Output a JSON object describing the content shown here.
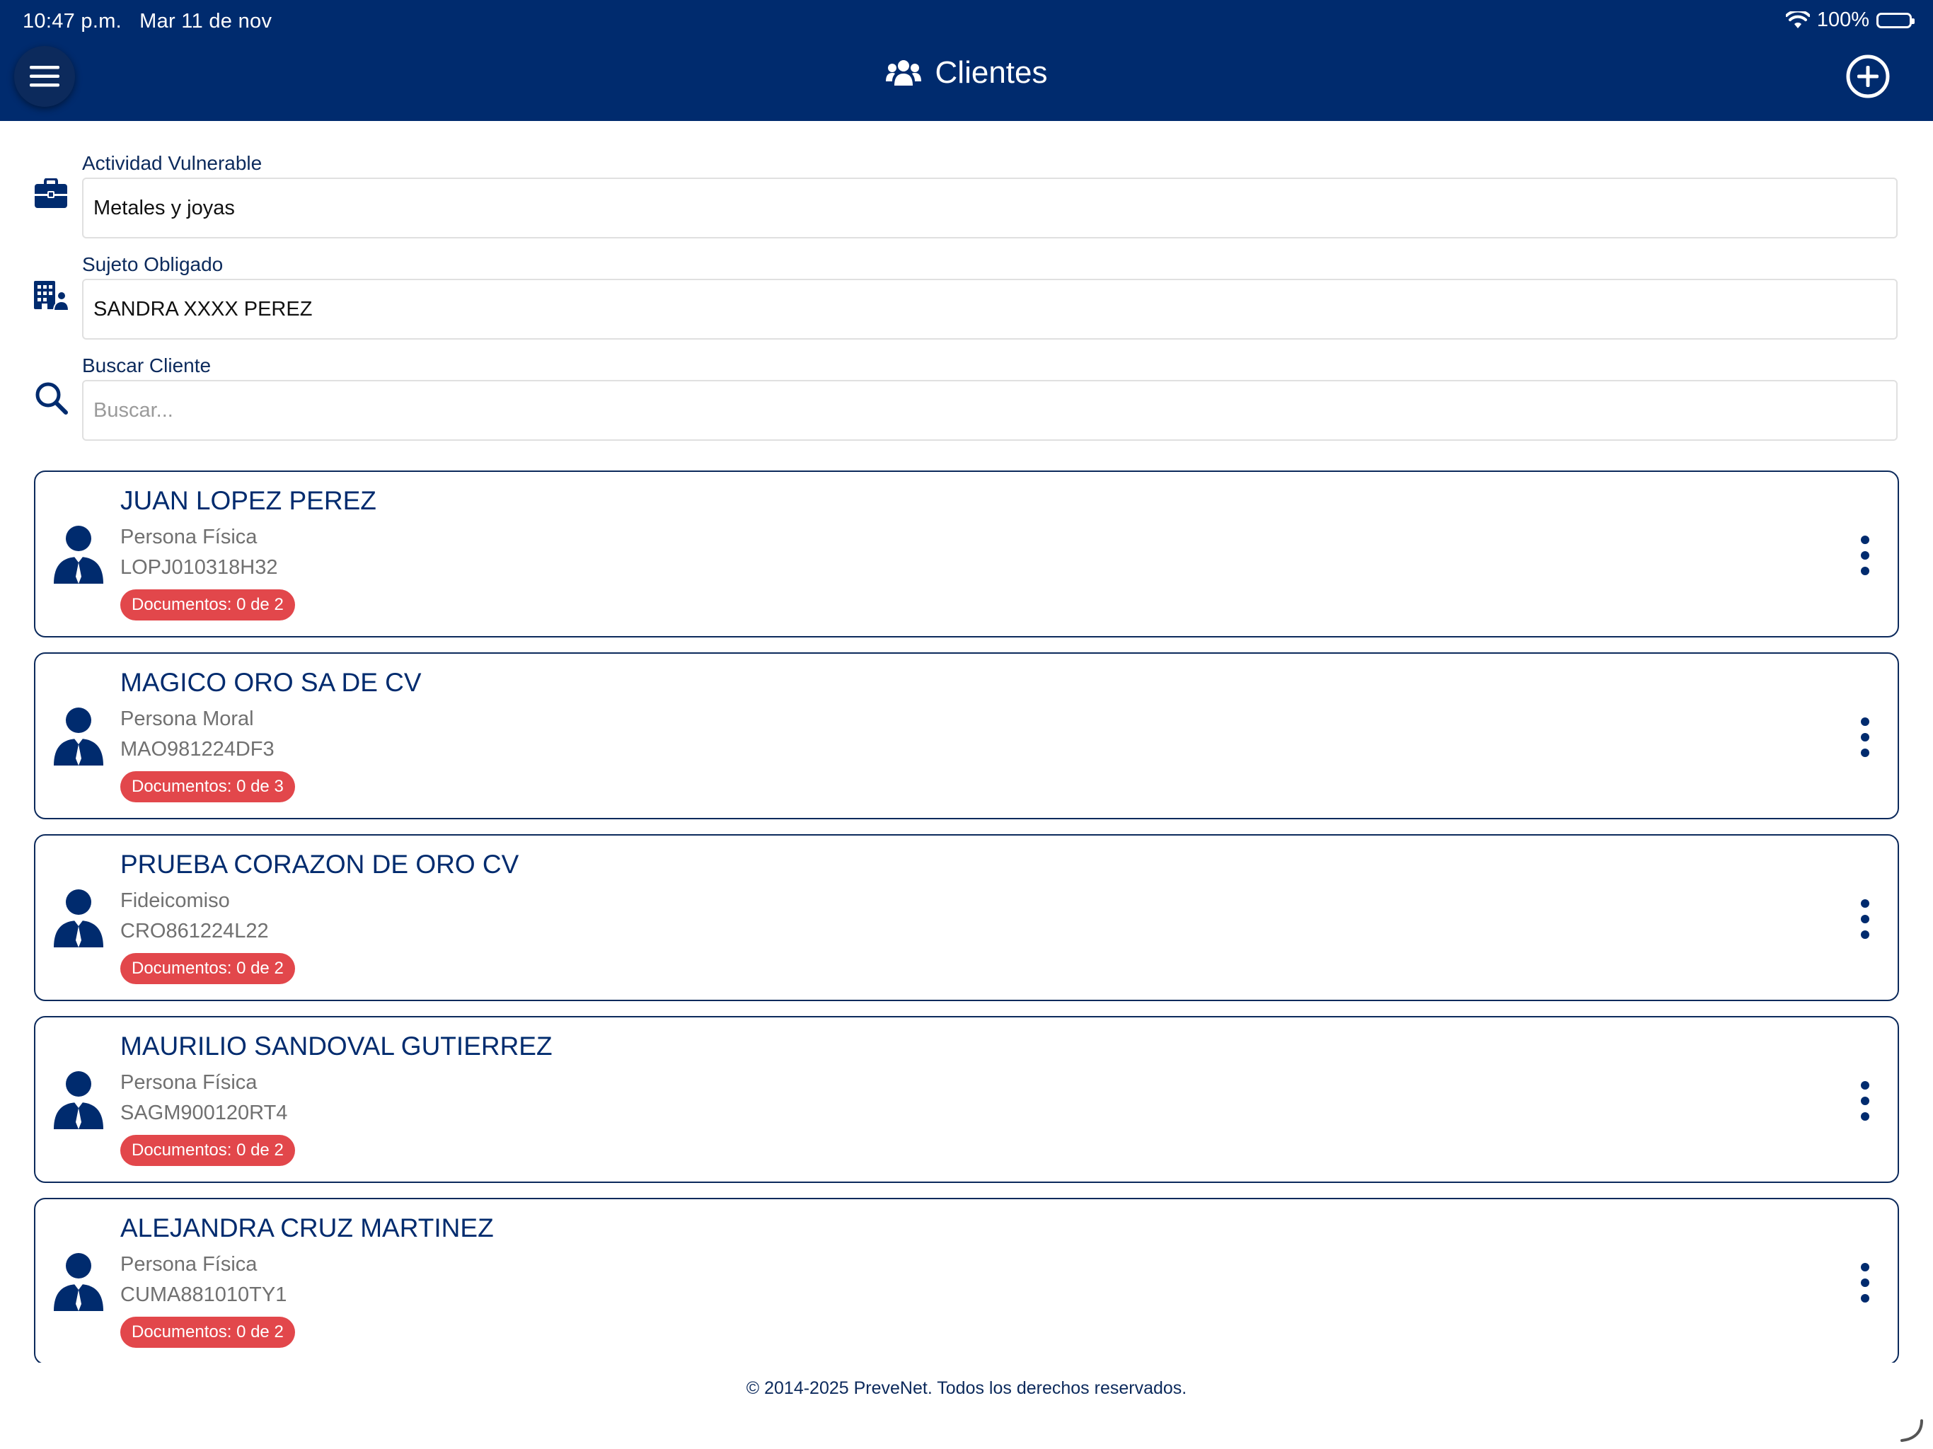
{
  "status_bar": {
    "time": "10:47 p.m.",
    "date": "Mar 11 de nov",
    "battery": "100%"
  },
  "header": {
    "title": "Clientes",
    "menu_icon": "hamburger-icon",
    "title_icon": "users-group-icon",
    "add_icon": "plus-circle-icon"
  },
  "filters": {
    "activity": {
      "label": "Actividad Vulnerable",
      "value": "Metales y joyas",
      "icon": "briefcase-icon"
    },
    "subject": {
      "label": "Sujeto Obligado",
      "value": "SANDRA XXXX PEREZ",
      "icon": "building-user-icon"
    },
    "search": {
      "label": "Buscar Cliente",
      "placeholder": "Buscar...",
      "value": "",
      "icon": "search-icon"
    }
  },
  "clients": [
    {
      "name": "JUAN LOPEZ PEREZ",
      "type": "Persona Física",
      "rfc": "LOPJ010318H32",
      "documents": "Documentos: 0 de 2"
    },
    {
      "name": "MAGICO ORO SA DE CV",
      "type": "Persona Moral",
      "rfc": "MAO981224DF3",
      "documents": "Documentos: 0 de 3"
    },
    {
      "name": "PRUEBA CORAZON DE ORO CV",
      "type": "Fideicomiso",
      "rfc": "CRO861224L22",
      "documents": "Documentos: 0 de 2"
    },
    {
      "name": "MAURILIO SANDOVAL GUTIERREZ",
      "type": "Persona Física",
      "rfc": "SAGM900120RT4",
      "documents": "Documentos: 0 de 2"
    },
    {
      "name": "ALEJANDRA CRUZ MARTINEZ",
      "type": "Persona Física",
      "rfc": "CUMA881010TY1",
      "documents": "Documentos: 0 de 2"
    }
  ],
  "footer": {
    "text": "© 2014-2025 PreveNet. Todos los derechos reservados."
  },
  "colors": {
    "primary": "#002b6e",
    "badge": "#e2474b",
    "muted_text": "#707070"
  }
}
